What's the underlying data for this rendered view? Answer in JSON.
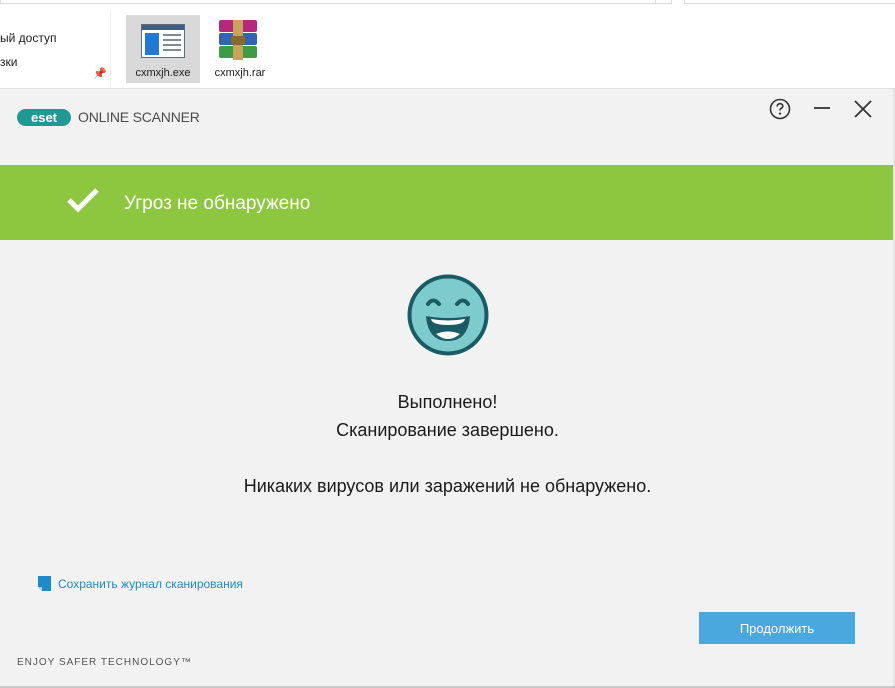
{
  "explorer": {
    "nav_items": [
      "ый доступ",
      "зки"
    ],
    "files": [
      {
        "name": "cxmxjh.exe",
        "icon": "exe-file-icon",
        "selected": true
      },
      {
        "name": "cxmxjh.rar",
        "icon": "winrar-archive-icon",
        "selected": false
      }
    ]
  },
  "window": {
    "brand": "eset",
    "product": "ONLINE SCANNER",
    "controls": {
      "help": "help-icon",
      "minimize": "minimize-icon",
      "close": "close-icon"
    }
  },
  "status": {
    "banner": "Угроз не обнаружено",
    "banner_color": "#8dc63f",
    "icon": "checkmark-icon"
  },
  "result": {
    "icon": "smiley-face-icon",
    "line1": "Выполнено!",
    "line2": "Сканирование завершено.",
    "line3": "Никаких вирусов или заражений не обнаружено."
  },
  "actions": {
    "save_log": "Сохранить журнал сканирования",
    "continue": "Продолжить"
  },
  "footer": "ENJOY SAFER TECHNOLOGY™",
  "colors": {
    "accent": "#4aa8de",
    "link": "#1f8ac9",
    "smiley_fill": "#7dcbcd",
    "smiley_stroke": "#1a5b64"
  }
}
